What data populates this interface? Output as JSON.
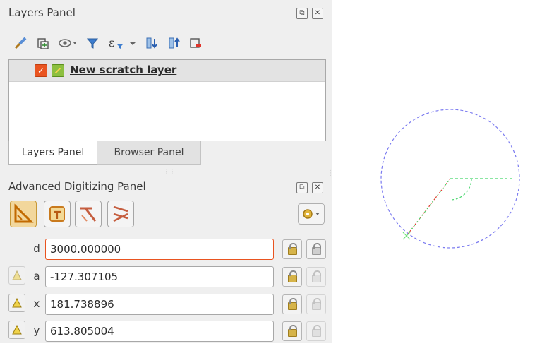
{
  "layers_panel": {
    "title": "Layers Panel",
    "float_icon": "float-icon",
    "close_icon": "close-icon",
    "toolbar_icons": [
      "style-brush-icon",
      "add-group-icon",
      "eye-dropdown-icon",
      "filter-icon",
      "expression-filter-icon",
      "dropdown-arrow-icon",
      "expand-all-icon",
      "collapse-all-icon",
      "remove-layer-icon"
    ],
    "layers": [
      {
        "name": "New scratch layer",
        "checked": true,
        "icon": "pencil-edit-icon"
      }
    ]
  },
  "tabs": [
    {
      "label": "Layers Panel",
      "active": true
    },
    {
      "label": "Browser Panel",
      "active": false
    }
  ],
  "adp": {
    "title": "Advanced Digitizing Panel",
    "tools": [
      "cad-ruler-icon",
      "construction-icon",
      "parallel-icon",
      "perpendicular-icon"
    ],
    "gear_icon": "settings-gear-icon",
    "fields": [
      {
        "label": "d",
        "value": "3000.000000",
        "focused": true,
        "has_warn": false
      },
      {
        "label": "a",
        "value": "-127.307105",
        "focused": false,
        "has_warn": true,
        "warn_dim": true
      },
      {
        "label": "x",
        "value": "181.738896",
        "focused": false,
        "has_warn": true,
        "warn_dim": false
      },
      {
        "label": "y",
        "value": "613.805004",
        "focused": false,
        "has_warn": true,
        "warn_dim": false
      }
    ]
  },
  "canvas": {
    "circle_color": "#7b7bf0",
    "guide_color": "#44d66a",
    "line_color": "#e0382a"
  }
}
